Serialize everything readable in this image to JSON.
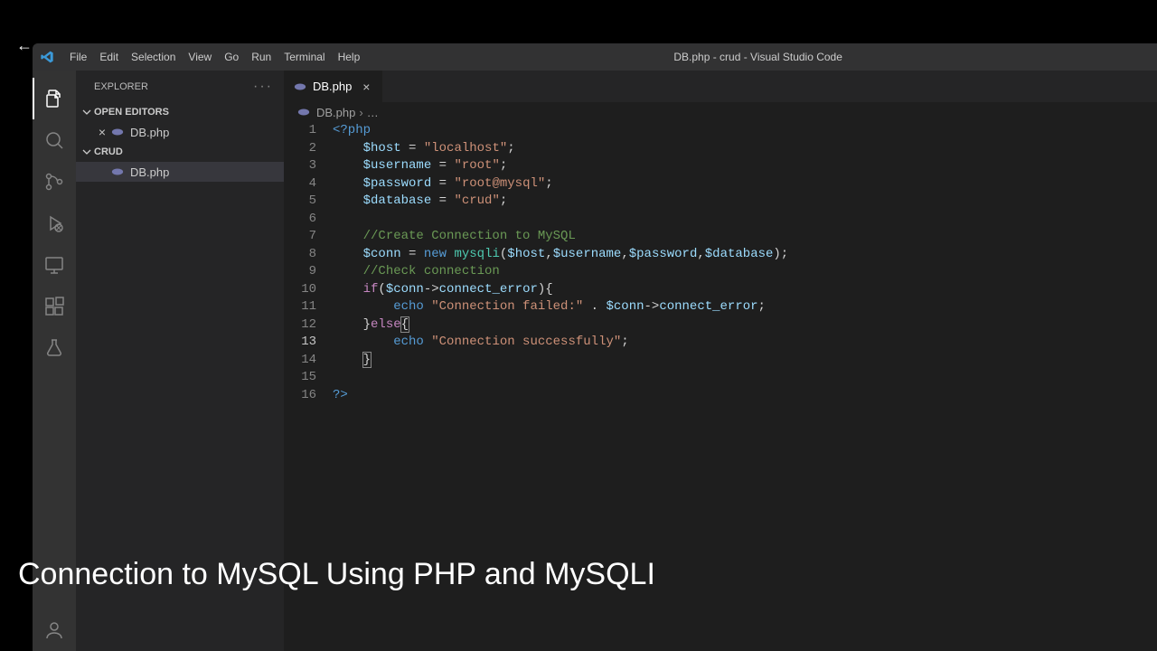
{
  "back_arrow": "←",
  "title_bar": {
    "menu": [
      "File",
      "Edit",
      "Selection",
      "View",
      "Go",
      "Run",
      "Terminal",
      "Help"
    ],
    "title": "DB.php - crud - Visual Studio Code"
  },
  "activity_bar": {
    "items": [
      {
        "name": "explorer-icon",
        "active": true
      },
      {
        "name": "search-icon",
        "active": false
      },
      {
        "name": "source-control-icon",
        "active": false
      },
      {
        "name": "run-debug-icon",
        "active": false
      },
      {
        "name": "remote-explorer-icon",
        "active": false
      },
      {
        "name": "extensions-icon",
        "active": false
      },
      {
        "name": "testing-icon",
        "active": false
      }
    ],
    "bottom": [
      {
        "name": "accounts-icon"
      }
    ]
  },
  "sidebar": {
    "title": "EXPLORER",
    "open_editors": {
      "label": "OPEN EDITORS",
      "items": [
        {
          "name": "DB.php"
        }
      ]
    },
    "workspace": {
      "label": "CRUD",
      "items": [
        {
          "name": "DB.php"
        }
      ]
    }
  },
  "tabs": [
    {
      "name": "DB.php"
    }
  ],
  "breadcrumb": {
    "file": "DB.php",
    "rest": "…"
  },
  "code": {
    "host": "localhost",
    "username": "root",
    "password": "root@mysql",
    "database": "crud",
    "comment_create": "//Create Connection to MySQL",
    "comment_check": "//Check connection",
    "fail_msg": "Connection failed:",
    "success_msg": "Connection successfully",
    "active_line": 13,
    "line_count": 16
  },
  "caption": "Connection to MySQL Using PHP and MySQLI"
}
